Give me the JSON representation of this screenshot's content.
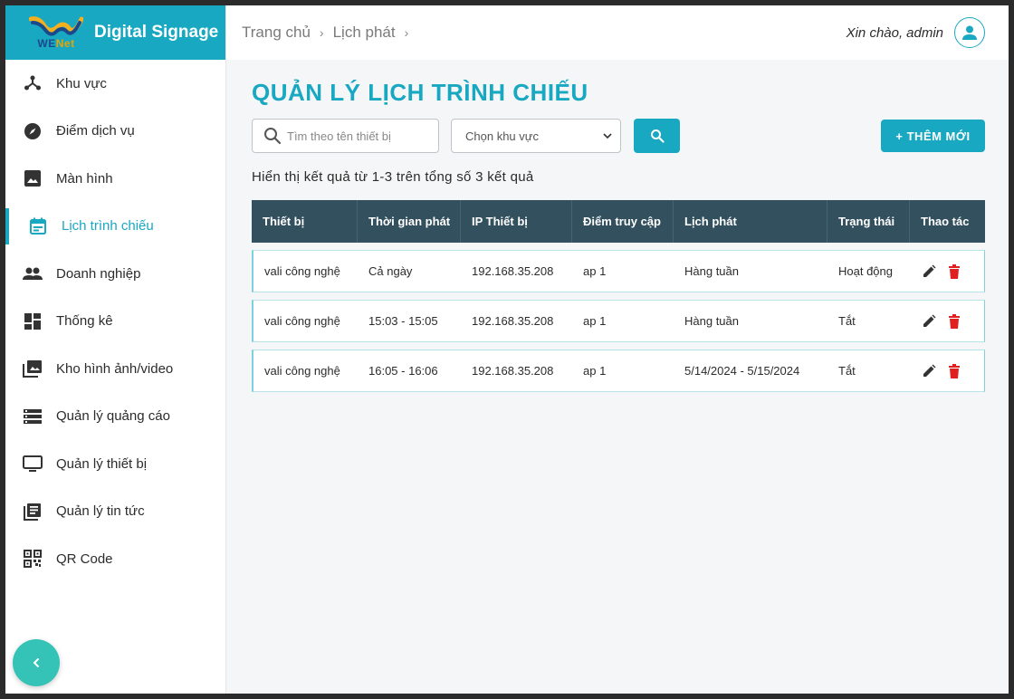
{
  "brand": {
    "logo_text_a": "WE",
    "logo_text_b": "Net",
    "title": "Digital Signage"
  },
  "sidebar": {
    "items": [
      {
        "label": "Khu vực",
        "icon": "hub-icon"
      },
      {
        "label": "Điểm dịch vụ",
        "icon": "compass-icon"
      },
      {
        "label": "Màn hình",
        "icon": "image-icon"
      },
      {
        "label": "Lịch trình chiếu",
        "icon": "calendar-icon",
        "active": true
      },
      {
        "label": "Doanh nghiệp",
        "icon": "people-icon"
      },
      {
        "label": "Thống kê",
        "icon": "dashboard-icon"
      },
      {
        "label": "Kho hình ảnh/video",
        "icon": "photo-library-icon"
      },
      {
        "label": "Quản lý quảng cáo",
        "icon": "list-icon"
      },
      {
        "label": "Quản lý thiết bị",
        "icon": "monitor-icon"
      },
      {
        "label": "Quản lý tin tức",
        "icon": "news-icon"
      },
      {
        "label": "QR Code",
        "icon": "qr-code-icon"
      }
    ]
  },
  "header": {
    "breadcrumb": [
      "Trang chủ",
      "Lịch phát"
    ],
    "greeting": "Xin chào,",
    "username": "admin"
  },
  "main": {
    "title": "QUẢN LÝ LỊCH TRÌNH CHIẾU",
    "search_placeholder": "Tìm theo tên thiết bị",
    "area_select_value": "Chọn khu vực",
    "add_button": "+ THÊM MỚI",
    "result_text": "Hiển thị kết quả từ 1-3 trên tổng số 3 kết quả"
  },
  "table": {
    "headers": [
      "Thiết bị",
      "Thời gian phát",
      "IP Thiết bị",
      "Điểm truy cập",
      "Lịch phát",
      "Trạng thái",
      "Thao tác"
    ],
    "rows": [
      [
        "vali công nghệ",
        "Cả ngày",
        "192.168.35.208",
        "ap 1",
        "Hàng tuần",
        "Hoạt động"
      ],
      [
        "vali công nghệ",
        "15:03 - 15:05",
        "192.168.35.208",
        "ap 1",
        "Hàng tuần",
        "Tắt"
      ],
      [
        "vali công nghệ",
        "16:05 - 16:06",
        "192.168.35.208",
        "ap 1",
        "5/14/2024 - 5/15/2024",
        "Tắt"
      ]
    ]
  },
  "colors": {
    "accent": "#18a8c2",
    "header_bg": "#33505f",
    "delete": "#e02020"
  }
}
